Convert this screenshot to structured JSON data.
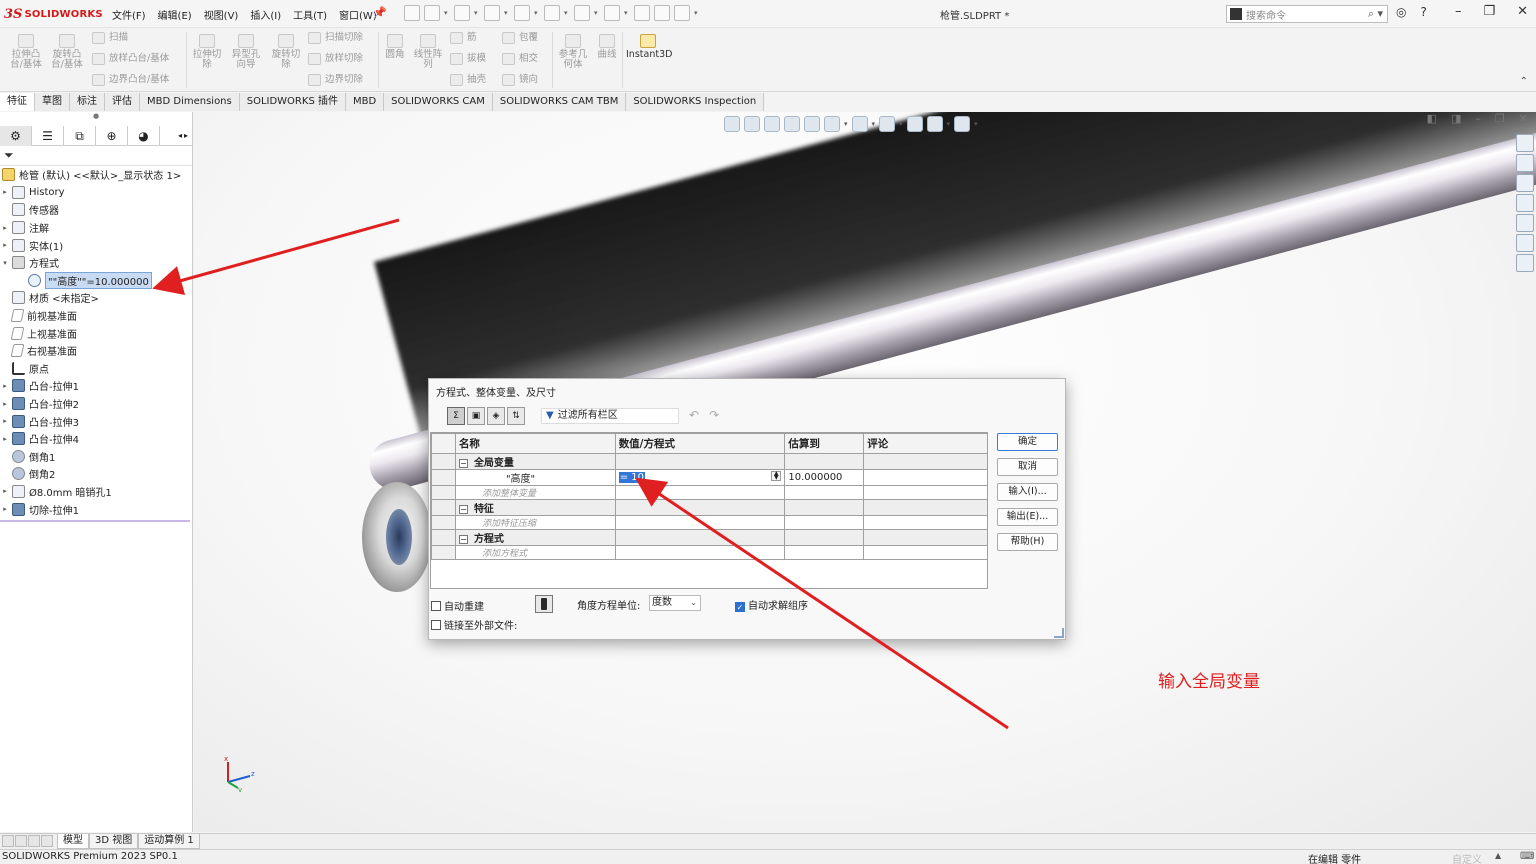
{
  "app": {
    "logo_ds": "3S",
    "logo_name": "SOLIDWORKS",
    "doc_title": "枪管.SLDPRT *",
    "search_placeholder": "搜索命令"
  },
  "menu": [
    "文件(F)",
    "编辑(E)",
    "视图(V)",
    "插入(I)",
    "工具(T)",
    "窗口(W)"
  ],
  "toolbar": {
    "extrude_boss": "拉伸凸\n台/基体",
    "revolve_boss": "旋转凸\n台/基体",
    "sweep": "扫描",
    "loft": "放样凸台/基体",
    "boundary_boss": "边界凸台/基体",
    "extrude_cut": "拉伸切\n除",
    "hole_wizard": "异型孔\n向导",
    "revolve_cut": "旋转切\n除",
    "swept_cut": "扫描切除",
    "lofted_cut": "放样切除",
    "boundary_cut": "边界切除",
    "fillet": "圆角",
    "linear_pattern": "线性阵\n列",
    "rib": "筋",
    "draft": "拔模",
    "shell": "抽壳",
    "wrap": "包覆",
    "intersect": "相交",
    "mirror": "镜向",
    "ref_geometry": "参考几\n何体",
    "curves": "曲线",
    "instant3d": "Instant3D"
  },
  "tabs": [
    "特征",
    "草图",
    "标注",
    "评估",
    "MBD Dimensions",
    "SOLIDWORKS 插件",
    "MBD",
    "SOLIDWORKS CAM",
    "SOLIDWORKS CAM TBM",
    "SOLIDWORKS Inspection"
  ],
  "tree": {
    "root": "枪管 (默认) <<默认>_显示状态 1>",
    "items": [
      {
        "label": "History",
        "exp": "▸"
      },
      {
        "label": "传感器",
        "exp": ""
      },
      {
        "label": "注解",
        "exp": "▸"
      },
      {
        "label": "实体(1)",
        "exp": "▸"
      },
      {
        "label": "方程式",
        "exp": "▾"
      },
      {
        "label": "\"\"高度\"\"=10.000000",
        "exp": ""
      },
      {
        "label": "材质 <未指定>",
        "exp": ""
      },
      {
        "label": "前视基准面",
        "exp": ""
      },
      {
        "label": "上视基准面",
        "exp": ""
      },
      {
        "label": "右视基准面",
        "exp": ""
      },
      {
        "label": "原点",
        "exp": ""
      },
      {
        "label": "凸台-拉伸1",
        "exp": "▸"
      },
      {
        "label": "凸台-拉伸2",
        "exp": "▸"
      },
      {
        "label": "凸台-拉伸3",
        "exp": "▸"
      },
      {
        "label": "凸台-拉伸4",
        "exp": "▸"
      },
      {
        "label": "倒角1",
        "exp": ""
      },
      {
        "label": "倒角2",
        "exp": ""
      },
      {
        "label": "Ø8.0mm 暗销孔1",
        "exp": "▸"
      },
      {
        "label": "切除-拉伸1",
        "exp": "▸"
      }
    ]
  },
  "dialog": {
    "title": "方程式、整体变量、及尺寸",
    "filter": "过滤所有栏区",
    "columns": [
      "名称",
      "数值/方程式",
      "估算到",
      "评论"
    ],
    "group_global": "全局变量",
    "var_name": "\"高度\"",
    "var_value": "= 10",
    "var_eval": "10.000000",
    "add_global": "添加整体变量",
    "group_feature": "特征",
    "add_feature": "添加特征压缩",
    "group_equation": "方程式",
    "add_equation": "添加方程式",
    "ok": "确定",
    "cancel": "取消",
    "import": "输入(I)...",
    "export": "输出(E)...",
    "help": "帮助(H)",
    "auto_rebuild": "自动重建",
    "link_external": "链接至外部文件:",
    "angle_unit_label": "角度方程单位:",
    "angle_unit": "度数",
    "auto_solve": "自动求解组序"
  },
  "annotation": "输入全局变量",
  "triad": {
    "x": "x",
    "y": "y",
    "z": "z"
  },
  "model_tabs": [
    "模型",
    "3D 视图",
    "运动算例 1"
  ],
  "status": {
    "left": "SOLIDWORKS Premium 2023 SP0.1",
    "right": "在编辑 零件",
    "custom": "自定义",
    "up": "▲"
  }
}
